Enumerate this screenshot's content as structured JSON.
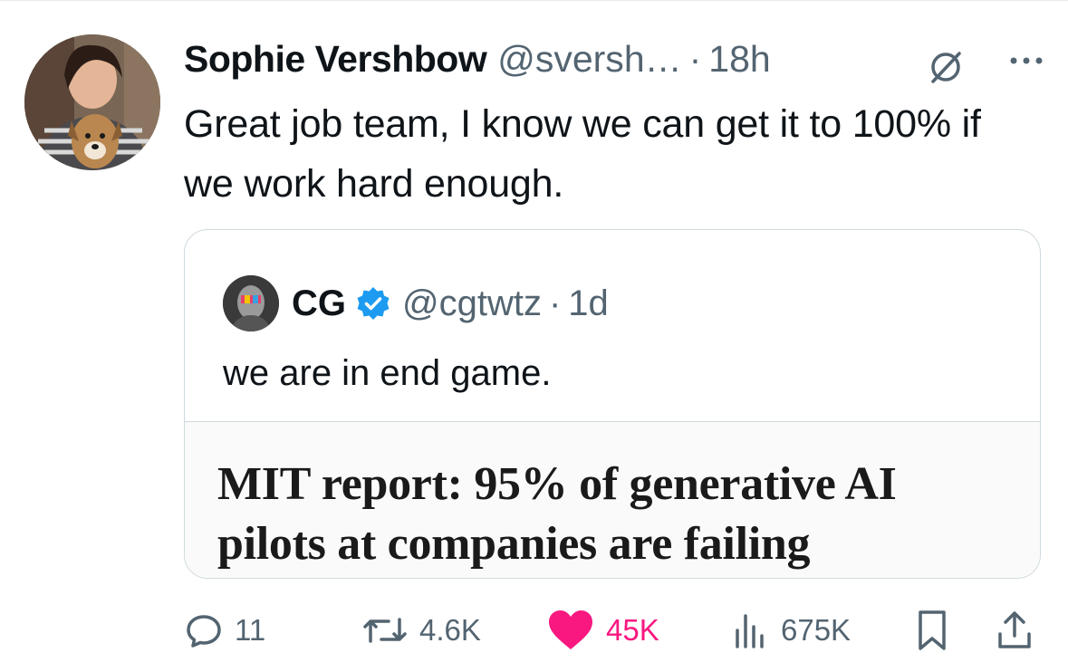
{
  "tweet": {
    "author_name": "Sophie Vershbow",
    "author_handle": "@svershbow_",
    "author_handle_truncated": "@svershbow",
    "time_dot": "·",
    "time": "18h",
    "text": "Great job team, I know we can get it to 100% if we work hard enough.",
    "icons": {
      "grok": "grok-slash-icon",
      "more": "more-dots-icon"
    }
  },
  "quote": {
    "author_name": "CG",
    "verified": true,
    "author_handle": "@cgtwtz",
    "time_dot": "·",
    "time": "1d",
    "text": "we are in end game.",
    "card_headline": "MIT report: 95% of generative AI pilots at companies are failing"
  },
  "actions": {
    "replies": "11",
    "reposts": "4.6K",
    "likes": "45K",
    "views": "675K",
    "liked": true
  },
  "colors": {
    "accent": "#1d9bf0",
    "like": "#f91880",
    "muted": "#536471",
    "border": "#cfd9de"
  }
}
